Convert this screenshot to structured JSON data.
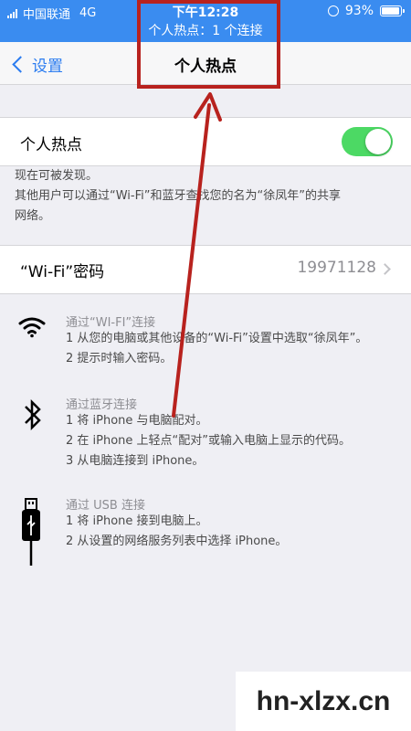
{
  "status_bar": {
    "carrier": "中国联通",
    "network": "4G",
    "time": "下午12:28",
    "hotspot_banner": "个人热点：1 个连接",
    "battery": "93%"
  },
  "nav": {
    "back_label": "设置",
    "title": "个人热点"
  },
  "hotspot_cell": {
    "label": "个人热点",
    "toggle_on": true
  },
  "discover_note": {
    "line1": "现在可被发现。",
    "line2": "其他用户可以通过“Wi-Fi”和蓝牙查找您的名为“徐凤年”的共享",
    "line3": "网络。"
  },
  "wifi_password": {
    "label": "“Wi-Fi”密码",
    "value": "19971128"
  },
  "sections": {
    "wifi": {
      "icon": "wifi-icon",
      "title": "通过“WI-FI”连接",
      "line1": "1 从您的电脑或其他设备的“Wi-Fi”设置中选取“徐凤年”。",
      "line2": "2 提示时输入密码。"
    },
    "bluetooth": {
      "icon": "bluetooth-icon",
      "title": "通过蓝牙连接",
      "line1": "1 将 iPhone 与电脑配对。",
      "line2": "2 在 iPhone 上轻点“配对”或输入电脑上显示的代码。",
      "line3": "3 从电脑连接到 iPhone。"
    },
    "usb": {
      "icon": "usb-cable-icon",
      "title": "通过 USB 连接",
      "line1": "1 将 iPhone 接到电脑上。",
      "line2": "2 从设置的网络服务列表中选择 iPhone。"
    }
  },
  "watermark": "hn-xlzx.cn",
  "colors": {
    "status_bar": "#3a8cf0",
    "ios_blue": "#2b7cf0",
    "toggle_on": "#4cd964",
    "annotation_red": "#b8221e"
  }
}
